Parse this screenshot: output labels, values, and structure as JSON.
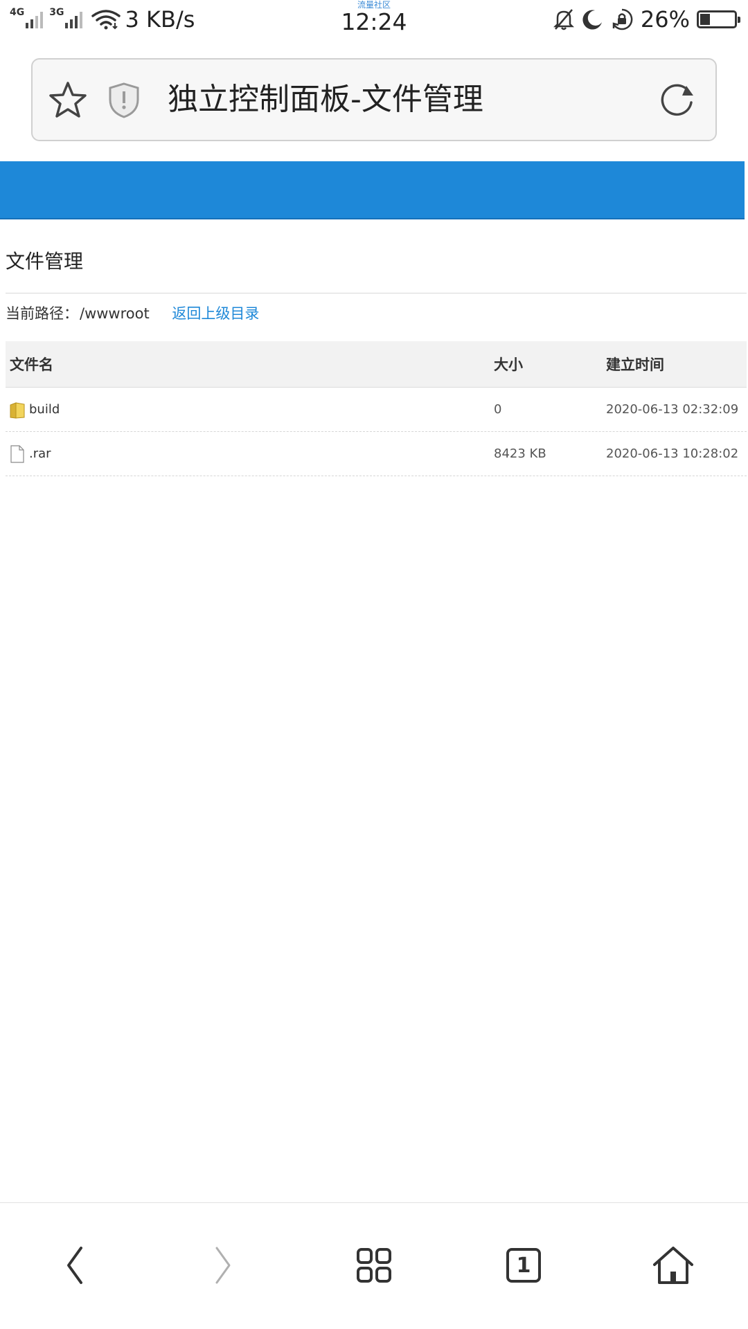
{
  "status_bar": {
    "network_1": "4G",
    "network_2": "3G",
    "net_speed": "3 KB/s",
    "carrier_label": "流量社区",
    "time": "12:24",
    "battery_percent": "26%",
    "battery_level": 0.26
  },
  "browser": {
    "page_title": "独立控制面板-文件管理"
  },
  "page": {
    "section_title": "文件管理",
    "path_label": "当前路径：",
    "path_value": "/wwwroot",
    "back_link": "返回上级目录",
    "table": {
      "columns": [
        "文件名",
        "大小",
        "建立时间"
      ],
      "rows": [
        {
          "icon": "folder-icon",
          "name": "build",
          "size": "0",
          "created": "2020-06-13 02:32:09"
        },
        {
          "icon": "file-icon",
          "name": ".rar",
          "size": "8423 KB",
          "created": "2020-06-13 10:28:02"
        }
      ]
    }
  },
  "toolbar": {
    "tab_count": "1",
    "icons": [
      "back-icon",
      "forward-icon",
      "menu-grid-icon",
      "tabs-icon",
      "home-icon"
    ]
  },
  "colors": {
    "header_blue": "#1e88d8",
    "link_blue": "#1e88d8"
  }
}
